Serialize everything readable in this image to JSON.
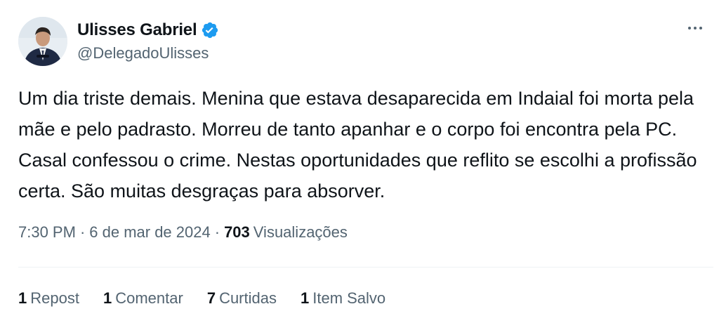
{
  "author": {
    "name": "Ulisses Gabriel",
    "handle": "@DelegadoUlisses",
    "verified_icon": "verified-badge-icon",
    "accent_color": "#1d9bf0"
  },
  "tweet": {
    "text": "Um dia triste demais. Menina que estava desaparecida em Indaial foi morta pela mãe e pelo padrasto. Morreu de tanto apanhar e o corpo foi encontra pela PC. Casal confessou o crime. Nestas oportunidades que reflito se escolhi a profissão certa. São muitas desgraças para absorver."
  },
  "meta": {
    "time": "7:30 PM",
    "separator": "·",
    "date": "6 de mar de 2024",
    "views_count": "703",
    "views_label": "Visualizações"
  },
  "stats": [
    {
      "count": "1",
      "label": "Repost"
    },
    {
      "count": "1",
      "label": "Comentar"
    },
    {
      "count": "7",
      "label": "Curtidas"
    },
    {
      "count": "1",
      "label": "Item Salvo"
    }
  ],
  "icons": {
    "more": "more-options-icon"
  }
}
